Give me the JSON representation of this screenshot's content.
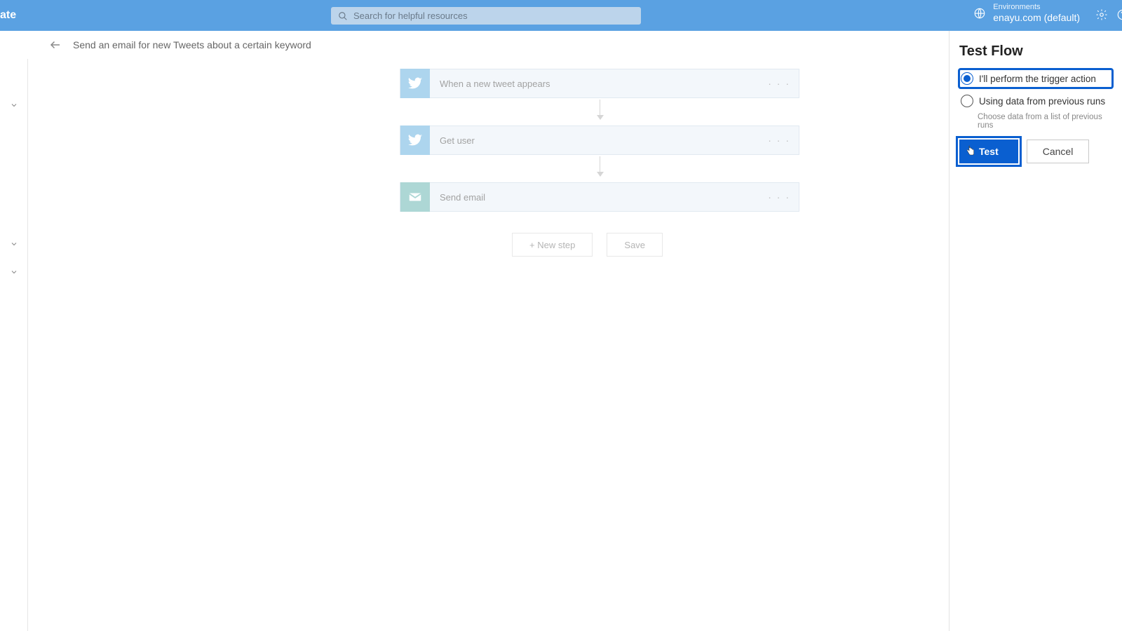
{
  "topbar": {
    "brand_fragment": "ate",
    "search_placeholder": "Search for helpful resources",
    "env_label": "Environments",
    "env_name": "enayu.com (default)"
  },
  "subbar": {
    "flow_title": "Send an email for new Tweets about a certain keyword"
  },
  "steps": [
    {
      "label": "When a new tweet appears",
      "icon": "twitter"
    },
    {
      "label": "Get user",
      "icon": "twitter"
    },
    {
      "label": "Send email",
      "icon": "mail"
    }
  ],
  "buttons": {
    "new_step": "+ New step",
    "save": "Save"
  },
  "panel": {
    "title": "Test Flow",
    "option_perform": "I'll perform the trigger action",
    "option_previous": "Using data from previous runs",
    "previous_hint": "Choose data from a list of previous runs",
    "test": "Test",
    "cancel": "Cancel",
    "selected": "perform"
  }
}
